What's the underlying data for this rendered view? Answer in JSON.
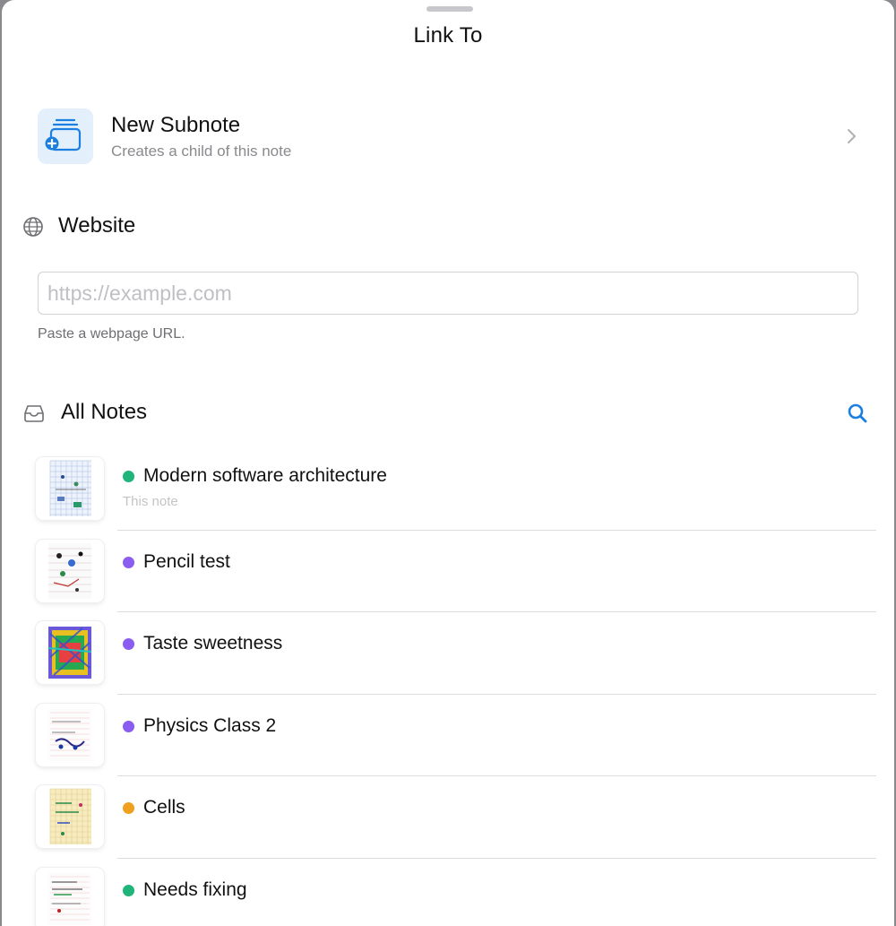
{
  "sheet": {
    "title": "Link To"
  },
  "subnote": {
    "title": "New Subnote",
    "subtitle": "Creates a child of this note",
    "icon": "new-subnote-icon"
  },
  "website": {
    "label": "Website",
    "icon": "globe-icon",
    "input_value": "",
    "placeholder": "https://example.com",
    "hint": "Paste a webpage URL."
  },
  "all_notes": {
    "label": "All Notes",
    "icon": "tray-icon",
    "search_icon": "search-icon",
    "accent": "#1a7fe0",
    "notes": [
      {
        "title": "Modern software architecture",
        "subtitle": "This note",
        "dot_color": "#1fb47a",
        "thumb": "grid-blue"
      },
      {
        "title": "Pencil test",
        "subtitle": "",
        "dot_color": "#8a5cf0",
        "thumb": "sketch"
      },
      {
        "title": "Taste sweetness",
        "subtitle": "",
        "dot_color": "#8a5cf0",
        "thumb": "colorful"
      },
      {
        "title": "Physics Class 2",
        "subtitle": "",
        "dot_color": "#8a5cf0",
        "thumb": "lined"
      },
      {
        "title": "Cells",
        "subtitle": "",
        "dot_color": "#f0a01f",
        "thumb": "yellow-grid"
      },
      {
        "title": "Needs fixing",
        "subtitle": "",
        "dot_color": "#1fb47a",
        "thumb": "lined-2"
      }
    ]
  }
}
